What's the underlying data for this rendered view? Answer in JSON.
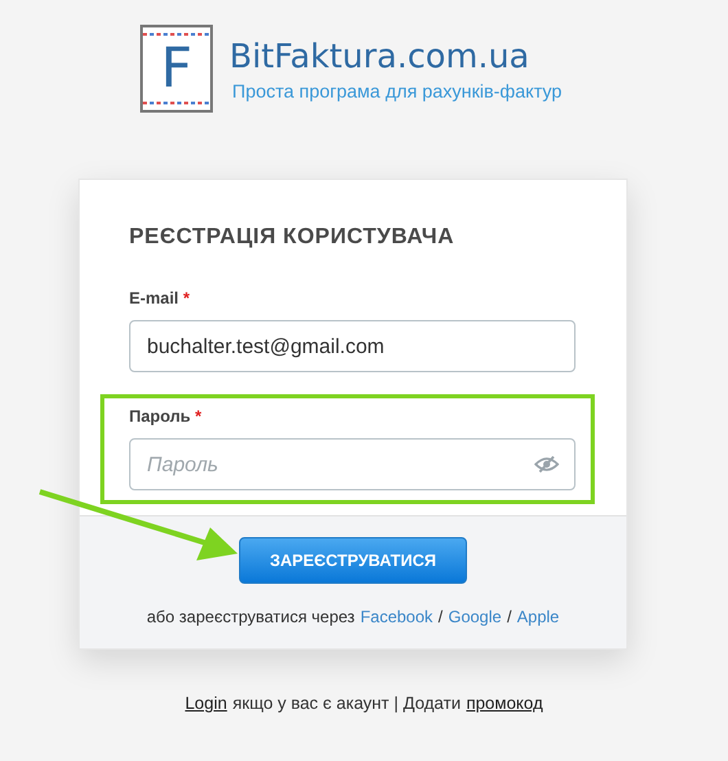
{
  "logo": {
    "letter": "F",
    "name": "BitFaktura.com.ua",
    "tagline": "Проста програма для рахунків-фактур"
  },
  "form": {
    "title": "РЕЄСТРАЦІЯ КОРИСТУВАЧА",
    "fields": [
      {
        "label": "E-mail",
        "required_mark": "*",
        "value": "buchalter.test@gmail.com",
        "highlighted": false,
        "kind": "text"
      },
      {
        "label": "Пароль",
        "required_mark": "*",
        "placeholder": "Пароль",
        "highlighted": true,
        "kind": "password"
      }
    ],
    "submit": {
      "label": "ЗАРЕЄСТРУВАТИСЯ",
      "pointed": true
    },
    "social": [
      {
        "kind": "text",
        "text": "або зареєструватися через"
      },
      {
        "kind": "link",
        "text": "Facebook"
      },
      {
        "kind": "text",
        "text": "/"
      },
      {
        "kind": "link",
        "text": "Google"
      },
      {
        "kind": "text",
        "text": "/"
      },
      {
        "kind": "link",
        "text": "Apple"
      }
    ]
  },
  "bottom": [
    {
      "kind": "link",
      "text": "Login"
    },
    {
      "kind": "text",
      "text": "якщо у вас є акаунт | Додати"
    },
    {
      "kind": "link",
      "text": "промокод"
    }
  ]
}
